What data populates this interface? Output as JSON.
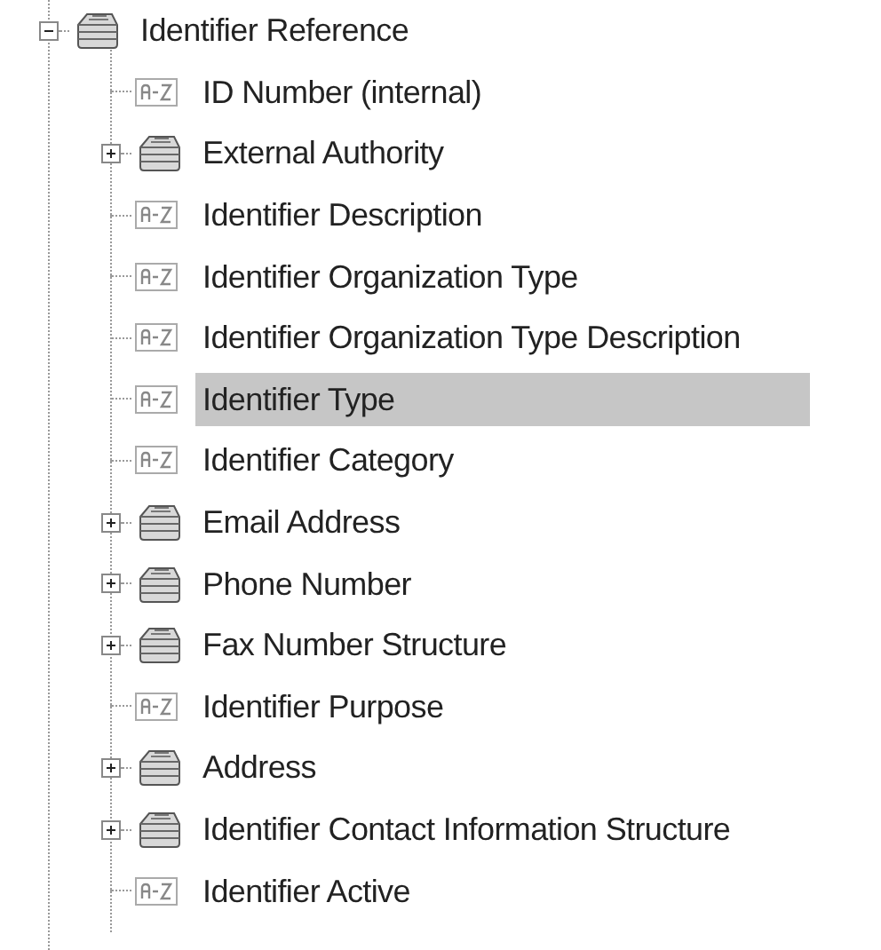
{
  "tree": {
    "label": "Identifier Reference",
    "kind": "folder",
    "expanded": true,
    "children": [
      {
        "label": "ID Number (internal)",
        "kind": "field",
        "selected": false
      },
      {
        "label": "External Authority",
        "kind": "folder",
        "expanded": false,
        "selected": false
      },
      {
        "label": "Identifier Description",
        "kind": "field",
        "selected": false
      },
      {
        "label": "Identifier Organization Type",
        "kind": "field",
        "selected": false
      },
      {
        "label": "Identifier Organization Type Description",
        "kind": "field",
        "selected": false
      },
      {
        "label": "Identifier Type",
        "kind": "field",
        "selected": true
      },
      {
        "label": "Identifier Category",
        "kind": "field",
        "selected": false
      },
      {
        "label": "Email Address",
        "kind": "folder",
        "expanded": false,
        "selected": false
      },
      {
        "label": "Phone Number",
        "kind": "folder",
        "expanded": false,
        "selected": false
      },
      {
        "label": "Fax Number Structure",
        "kind": "folder",
        "expanded": false,
        "selected": false
      },
      {
        "label": "Identifier Purpose",
        "kind": "field",
        "selected": false
      },
      {
        "label": "Address",
        "kind": "folder",
        "expanded": false,
        "selected": false
      },
      {
        "label": "Identifier Contact Information Structure",
        "kind": "folder",
        "expanded": false,
        "selected": false
      },
      {
        "label": "Identifier Active",
        "kind": "field",
        "selected": false
      }
    ]
  }
}
